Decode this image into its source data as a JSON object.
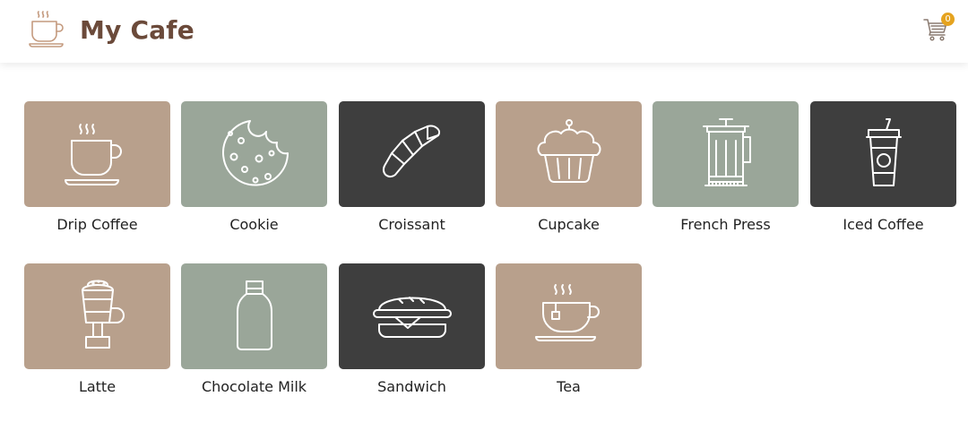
{
  "app": {
    "title": "My Cafe"
  },
  "cart": {
    "count": "0",
    "badge_color": "#e5a31f"
  },
  "colors": {
    "brand_text": "#6b4a3a",
    "tile_tan": "#b8a08c",
    "tile_sage": "#9aa699",
    "tile_dark": "#3e3e3e"
  },
  "menu": {
    "items": [
      {
        "label": "Drip Coffee",
        "icon": "coffee-cup-icon",
        "tile": "tan"
      },
      {
        "label": "Cookie",
        "icon": "cookie-icon",
        "tile": "sage"
      },
      {
        "label": "Croissant",
        "icon": "croissant-icon",
        "tile": "dark"
      },
      {
        "label": "Cupcake",
        "icon": "cupcake-icon",
        "tile": "tan"
      },
      {
        "label": "French Press",
        "icon": "french-press-icon",
        "tile": "sage"
      },
      {
        "label": "Iced Coffee",
        "icon": "iced-coffee-icon",
        "tile": "dark"
      },
      {
        "label": "Latte",
        "icon": "latte-glass-icon",
        "tile": "tan"
      },
      {
        "label": "Chocolate Milk",
        "icon": "milk-bottle-icon",
        "tile": "sage"
      },
      {
        "label": "Sandwich",
        "icon": "sandwich-icon",
        "tile": "dark"
      },
      {
        "label": "Tea",
        "icon": "tea-cup-icon",
        "tile": "tan"
      }
    ]
  }
}
